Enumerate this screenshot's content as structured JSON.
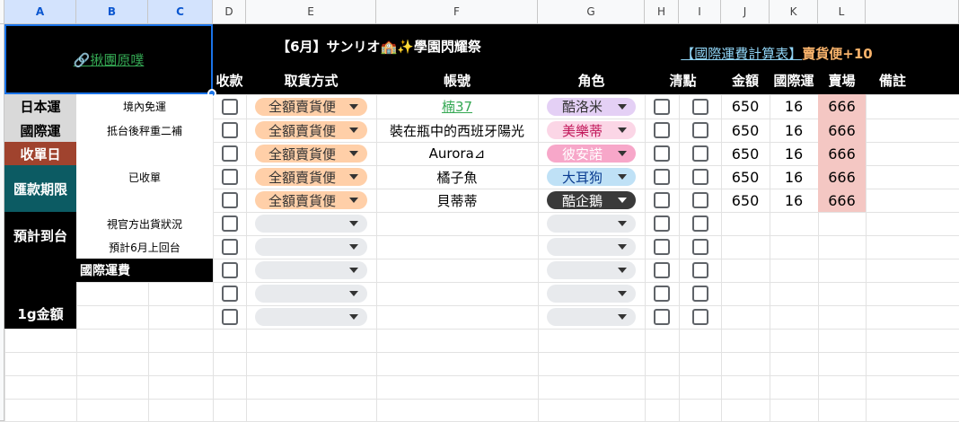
{
  "columns": [
    "A",
    "B",
    "C",
    "D",
    "E",
    "F",
    "G",
    "H",
    "I",
    "J",
    "K",
    "L"
  ],
  "header": {
    "link": "🔗揪團原噗",
    "title": "【6月】サンリオ🏫✨學園閃耀祭",
    "calc_link": "【國際運費計算表】",
    "calc_suffix": "賣貨便+10",
    "cols": {
      "paid": "收款",
      "pickup": "取貨方式",
      "account": "帳號",
      "character": "角色",
      "check": "清點",
      "amount": "金額",
      "intl": "國際運",
      "store": "賣場",
      "note": "備註"
    }
  },
  "info": {
    "jp_shipping": "日本運",
    "jp_shipping_val": "境內免運",
    "intl_shipping": "國際運",
    "intl_shipping_val": "抵台後秤重二補",
    "close_date": "收單日",
    "closed": "已收單",
    "pay_deadline": "匯款期限",
    "arrival": "預計到台",
    "arrival_1": "視官方出貨狀況",
    "arrival_2": "預計6月上回台",
    "intl_fee": "國際運費",
    "gram_price": "1g金額"
  },
  "orders": [
    {
      "pickup": "全額賣貨便",
      "account": "楠37",
      "character": "酷洛米",
      "char_bg": "#e4d0f5",
      "char_fg": "#333",
      "amount": "650",
      "intl": "16",
      "store": "666",
      "link": true
    },
    {
      "pickup": "全額賣貨便",
      "account": "裝在瓶中的西班牙陽光",
      "character": "美樂蒂",
      "char_bg": "#fbd6e6",
      "char_fg": "#c2185b",
      "amount": "650",
      "intl": "16",
      "store": "666",
      "link": false
    },
    {
      "pickup": "全額賣貨便",
      "account": "Aurora⊿",
      "character": "彼安諾",
      "char_bg": "#f7a7c9",
      "char_fg": "#fff",
      "amount": "650",
      "intl": "16",
      "store": "666",
      "link": false
    },
    {
      "pickup": "全額賣貨便",
      "account": "橘子魚",
      "character": "大耳狗",
      "char_bg": "#bfe1f6",
      "char_fg": "#0a3d91",
      "amount": "650",
      "intl": "16",
      "store": "666",
      "link": false
    },
    {
      "pickup": "全額賣貨便",
      "account": "貝蒂蒂",
      "character": "酷企鵝",
      "char_bg": "#3a3a3a",
      "char_fg": "#fff",
      "amount": "650",
      "intl": "16",
      "store": "666",
      "link": false
    }
  ],
  "colors": {
    "pickup_chip": "#ffcfa8",
    "empty_chip": "#e8eaed",
    "store_bg": "#f4c7c3",
    "link_green": "#34a853",
    "calc_blue": "#8fd3f4",
    "calc_orange": "#f9b36b",
    "close_red": "#a0432e",
    "deadline_teal": "#0c5b63"
  }
}
